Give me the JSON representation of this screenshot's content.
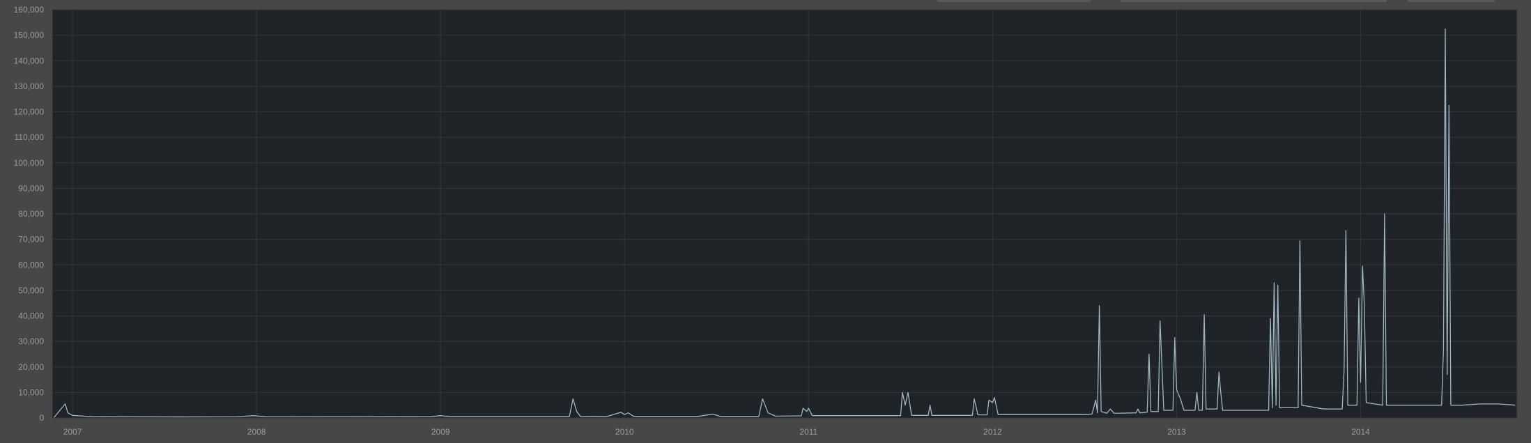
{
  "chart_data": {
    "type": "line",
    "title": "",
    "xlabel": "",
    "ylabel": "",
    "ylim": [
      0,
      160000
    ],
    "yticks": [
      0,
      10000,
      20000,
      30000,
      40000,
      50000,
      60000,
      70000,
      80000,
      90000,
      100000,
      110000,
      120000,
      130000,
      140000,
      150000,
      160000
    ],
    "ytick_labels": [
      "0",
      "10,000",
      "20,000",
      "30,000",
      "40,000",
      "50,000",
      "60,000",
      "70,000",
      "80,000",
      "90,000",
      "100,000",
      "110,000",
      "120,000",
      "130,000",
      "140,000",
      "150,000",
      "160,000"
    ],
    "xlim": [
      2006.89,
      2014.85
    ],
    "xticks": [
      2007,
      2008,
      2009,
      2010,
      2011,
      2012,
      2013,
      2014
    ],
    "xtick_labels": [
      "2007",
      "2008",
      "2009",
      "2010",
      "2011",
      "2012",
      "2013",
      "2014"
    ],
    "grid": true,
    "colors": {
      "line": "#9fb8c6",
      "plot_background": "#202327",
      "page_background": "#474747",
      "grid": "#33373d",
      "tick_text": "#9a9a9a"
    },
    "series": [
      {
        "points": [
          [
            2006.9,
            200
          ],
          [
            2006.96,
            5500
          ],
          [
            2006.975,
            2000
          ],
          [
            2007.0,
            1000
          ],
          [
            2007.1,
            500
          ],
          [
            2007.3,
            450
          ],
          [
            2007.6,
            400
          ],
          [
            2007.9,
            450
          ],
          [
            2007.98,
            900
          ],
          [
            2008.05,
            500
          ],
          [
            2008.5,
            450
          ],
          [
            2008.95,
            500
          ],
          [
            2009.0,
            900
          ],
          [
            2009.05,
            500
          ],
          [
            2009.5,
            500
          ],
          [
            2009.7,
            500
          ],
          [
            2009.72,
            7500
          ],
          [
            2009.74,
            2500
          ],
          [
            2009.76,
            600
          ],
          [
            2009.9,
            500
          ],
          [
            2009.98,
            2200
          ],
          [
            2010.0,
            1300
          ],
          [
            2010.02,
            2000
          ],
          [
            2010.05,
            600
          ],
          [
            2010.4,
            600
          ],
          [
            2010.48,
            1500
          ],
          [
            2010.52,
            600
          ],
          [
            2010.73,
            600
          ],
          [
            2010.75,
            7500
          ],
          [
            2010.78,
            2000
          ],
          [
            2010.82,
            700
          ],
          [
            2010.96,
            800
          ],
          [
            2010.97,
            3800
          ],
          [
            2010.99,
            2500
          ],
          [
            2011.0,
            3800
          ],
          [
            2011.02,
            900
          ],
          [
            2011.5,
            900
          ],
          [
            2011.51,
            10000
          ],
          [
            2011.525,
            5000
          ],
          [
            2011.54,
            10000
          ],
          [
            2011.56,
            1000
          ],
          [
            2011.65,
            1000
          ],
          [
            2011.66,
            5000
          ],
          [
            2011.67,
            1000
          ],
          [
            2011.89,
            1000
          ],
          [
            2011.9,
            7500
          ],
          [
            2011.92,
            1200
          ],
          [
            2011.97,
            1200
          ],
          [
            2011.98,
            7000
          ],
          [
            2012.0,
            6000
          ],
          [
            2012.01,
            8000
          ],
          [
            2012.03,
            1300
          ],
          [
            2012.5,
            1300
          ],
          [
            2012.54,
            1500
          ],
          [
            2012.56,
            7000
          ],
          [
            2012.57,
            2000
          ],
          [
            2012.58,
            44000
          ],
          [
            2012.59,
            2500
          ],
          [
            2012.62,
            1800
          ],
          [
            2012.64,
            3500
          ],
          [
            2012.66,
            1800
          ],
          [
            2012.78,
            2000
          ],
          [
            2012.79,
            3500
          ],
          [
            2012.8,
            2000
          ],
          [
            2012.84,
            2200
          ],
          [
            2012.85,
            25000
          ],
          [
            2012.86,
            2500
          ],
          [
            2012.9,
            2500
          ],
          [
            2012.91,
            38000
          ],
          [
            2012.93,
            3000
          ],
          [
            2012.98,
            3000
          ],
          [
            2012.99,
            31500
          ],
          [
            2013.0,
            11000
          ],
          [
            2013.02,
            7500
          ],
          [
            2013.04,
            3000
          ],
          [
            2013.1,
            3000
          ],
          [
            2013.11,
            10000
          ],
          [
            2013.12,
            3000
          ],
          [
            2013.14,
            3000
          ],
          [
            2013.15,
            40500
          ],
          [
            2013.16,
            3500
          ],
          [
            2013.22,
            3500
          ],
          [
            2013.23,
            18000
          ],
          [
            2013.24,
            10000
          ],
          [
            2013.25,
            3000
          ],
          [
            2013.5,
            3000
          ],
          [
            2013.51,
            39000
          ],
          [
            2013.52,
            4000
          ],
          [
            2013.53,
            53000
          ],
          [
            2013.54,
            5000
          ],
          [
            2013.55,
            52000
          ],
          [
            2013.56,
            4000
          ],
          [
            2013.66,
            4000
          ],
          [
            2013.67,
            69500
          ],
          [
            2013.68,
            5000
          ],
          [
            2013.8,
            3500
          ],
          [
            2013.9,
            3500
          ],
          [
            2013.91,
            19000
          ],
          [
            2013.92,
            73500
          ],
          [
            2013.93,
            5000
          ],
          [
            2013.98,
            5000
          ],
          [
            2013.99,
            47000
          ],
          [
            2014.0,
            14000
          ],
          [
            2014.01,
            59500
          ],
          [
            2014.02,
            44500
          ],
          [
            2014.03,
            6000
          ],
          [
            2014.12,
            5000
          ],
          [
            2014.13,
            80000
          ],
          [
            2014.14,
            5000
          ],
          [
            2014.3,
            5000
          ],
          [
            2014.44,
            5000
          ],
          [
            2014.45,
            27000
          ],
          [
            2014.46,
            152500
          ],
          [
            2014.47,
            17000
          ],
          [
            2014.48,
            122500
          ],
          [
            2014.49,
            5000
          ],
          [
            2014.55,
            5000
          ],
          [
            2014.65,
            5500
          ],
          [
            2014.75,
            5500
          ],
          [
            2014.84,
            5000
          ]
        ]
      }
    ]
  }
}
